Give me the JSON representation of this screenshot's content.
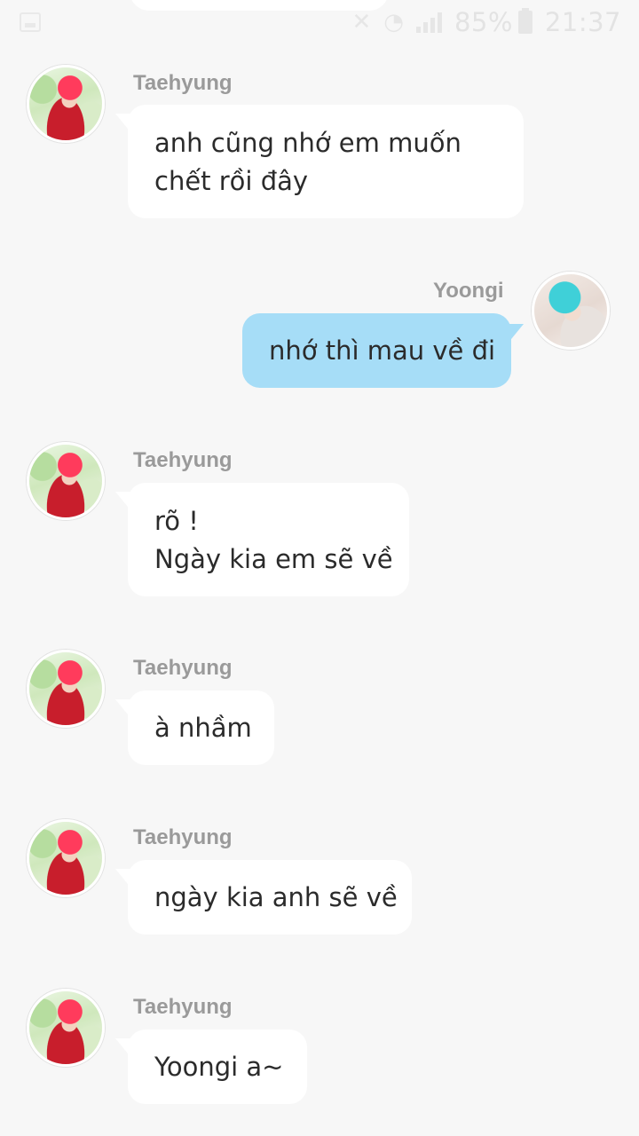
{
  "status_bar": {
    "battery": "85%",
    "time": "21:37",
    "icons": [
      "gallery-icon",
      "mute-icon",
      "wifi-icon",
      "signal-icon",
      "battery-icon"
    ]
  },
  "colors": {
    "background": "#f7f7f7",
    "incoming_bubble": "#ffffff",
    "outgoing_bubble": "#a6ddf7",
    "sender_name": "#9a9a9a",
    "message_text": "#2b2b2b"
  },
  "messages": [
    {
      "sender": "Taehyung",
      "direction": "incoming",
      "lines": [
        "anh cũng nhớ em muốn",
        "chết rồi đây"
      ]
    },
    {
      "sender": "Yoongi",
      "direction": "outgoing",
      "lines": [
        "nhớ thì mau về đi"
      ]
    },
    {
      "sender": "Taehyung",
      "direction": "incoming",
      "lines": [
        "rõ !",
        "Ngày kia em sẽ về"
      ]
    },
    {
      "sender": "Taehyung",
      "direction": "incoming",
      "lines": [
        "à nhầm"
      ]
    },
    {
      "sender": "Taehyung",
      "direction": "incoming",
      "lines": [
        "ngày kia anh sẽ về"
      ]
    },
    {
      "sender": "Taehyung",
      "direction": "incoming",
      "lines": [
        "Yoongi a~"
      ]
    }
  ]
}
